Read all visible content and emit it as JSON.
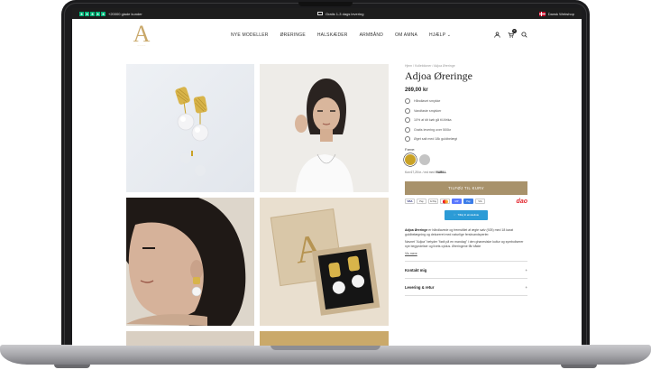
{
  "topbar": {
    "reviews_text": "+20000 glade kunder",
    "shipping_text": "Gratis 1-3 dags levering",
    "store_text": "Dansk Webshop"
  },
  "header": {
    "logo_letter": "A",
    "nav": [
      "NYE MODELLER",
      "ØRERINGE",
      "HALSKÆDER",
      "ARMBÅND",
      "OM AMNA",
      "HJÆLP"
    ],
    "cart_count": "0"
  },
  "product": {
    "breadcrumb": "Hjem  /  Kollektioner  /  Adjoa Øreringe",
    "title": "Adjoa Øreringe",
    "price": "269,00 kr",
    "features": [
      "Håndlavet smykke",
      "Vandfaste smykker",
      "10% af dit køb gå til Afrika",
      "Gratis levering over 500kr",
      "Øget salt med 18k guldbelægt"
    ],
    "color_label": "Farve:",
    "viabill_text": "Kun 67,25 kr. / md med",
    "viabill_brand": "VIABILL",
    "cart_button": "TILFØJ TIL KURV",
    "payments": [
      "VISA",
      "Pay",
      "G Pay",
      "MC",
      "MP",
      "Pay",
      "VIA"
    ],
    "dao": "dao",
    "notify_button": "Tilføj til ønskeliste",
    "desc_title": "Adjoa Øreringe",
    "desc_p1": " er håndlavede og fremstillet af ægte sølv (925) med 18 karat guldbelægning og dekoreret med naturlige ferskvandsperler.",
    "desc_p2": "Navnet \"Adjoa\" betyder \"født på en mandag\" i den ghanesiske kultur og symboliserer nye begyndelser og livets cyklus. Øreringene får bålde",
    "read_more": "Vis mere",
    "accordions": [
      "Kontakt mig",
      "Levering & retur"
    ]
  },
  "colors": {
    "accent": "#a8926b",
    "gold_swatch": "#c9a227",
    "silver_swatch": "#c4c4c4",
    "trustpilot": "#00b67a",
    "dao_red": "#e3262e"
  }
}
